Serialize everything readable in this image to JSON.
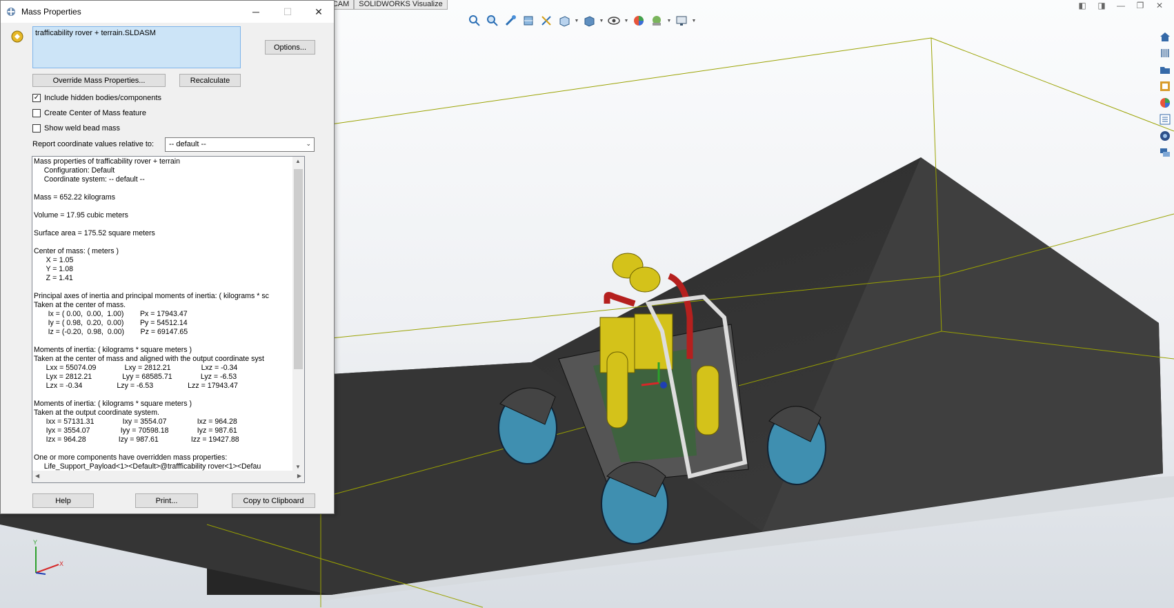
{
  "top_tabs": [
    "...RKS CAM",
    "SOLIDWORKS Visualize"
  ],
  "heads_up_icons": [
    "zoom-to-fit-icon",
    "zoom-area-icon",
    "previous-view-icon",
    "section-view-icon",
    "view-orientation-icon",
    "display-style-icon",
    "hide-show-icon",
    "edit-appearance-icon",
    "apply-scene-icon",
    "view-settings-icon"
  ],
  "task_pane_icons": [
    "home-icon",
    "parts-library-icon",
    "file-explorer-icon",
    "view-palette-icon",
    "appearances-icon",
    "custom-properties-icon",
    "solidworks-resources-icon",
    "forum-icon"
  ],
  "dialog": {
    "title": "Mass Properties",
    "selection": "trafficability rover + terrain.SLDASM",
    "options_label": "Options...",
    "override_label": "Override Mass Properties...",
    "recalculate_label": "Recalculate",
    "checkboxes": [
      {
        "label": "Include hidden bodies/components",
        "checked": true
      },
      {
        "label": "Create Center of Mass feature",
        "checked": false
      },
      {
        "label": "Show weld bead mass",
        "checked": false
      }
    ],
    "report_relative_label": "Report coordinate values relative to:",
    "coord_value": "-- default --",
    "report_lines": [
      "Mass properties of trafficability rover + terrain",
      "     Configuration: Default",
      "     Coordinate system: -- default --",
      "",
      "Mass = 652.22 kilograms",
      "",
      "Volume = 17.95 cubic meters",
      "",
      "Surface area = 175.52 square meters",
      "",
      "Center of mass: ( meters )",
      "      X = 1.05",
      "      Y = 1.08",
      "      Z = 1.41",
      "",
      "Principal axes of inertia and principal moments of inertia: ( kilograms * sc",
      "Taken at the center of mass.",
      "       Ix = ( 0.00,  0.00,  1.00)        Px = 17943.47",
      "       Iy = ( 0.98,  0.20,  0.00)        Py = 54512.14",
      "       Iz = (-0.20,  0.98,  0.00)        Pz = 69147.65",
      "",
      "Moments of inertia: ( kilograms * square meters )",
      "Taken at the center of mass and aligned with the output coordinate syst",
      "      Lxx = 55074.09              Lxy = 2812.21               Lxz = -0.34",
      "      Lyx = 2812.21               Lyy = 68585.71              Lyz = -6.53",
      "      Lzx = -0.34                 Lzy = -6.53                 Lzz = 17943.47",
      "",
      "Moments of inertia: ( kilograms * square meters )",
      "Taken at the output coordinate system.",
      "      Ixx = 57131.31              Ixy = 3554.07               Ixz = 964.28",
      "      Iyx = 3554.07               Iyy = 70598.18              Iyz = 987.61",
      "      Izx = 964.28                Izy = 987.61                Izz = 19427.88",
      "",
      "One or more components have overridden mass properties:",
      "     Life_Support_Payload<1><Default>@traffficability rover<1><Defau"
    ],
    "help_label": "Help",
    "print_label": "Print...",
    "copy_label": "Copy to Clipboard"
  },
  "triad": {
    "x": "X",
    "y": "Y"
  },
  "colors": {
    "terrain": "#3a3a3a",
    "bbox_line": "#9aa200",
    "rover_yellow": "#d4c21a",
    "wheel_blue": "#3f8fb0",
    "rollbar_red": "#b5201e"
  }
}
